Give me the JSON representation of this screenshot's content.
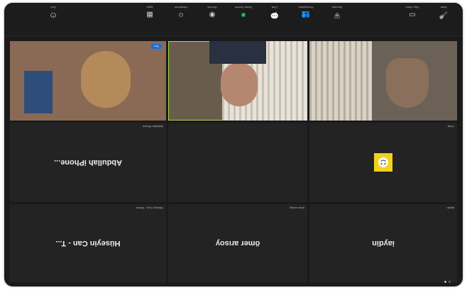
{
  "participants": [
    {
      "display_name": "Abdullah iPhone...",
      "tag": "Abdullah iPhone",
      "type": "name"
    },
    {
      "display_name": "Hüseyin Can - T...",
      "tag": "Hüseyin Can - Teknik",
      "type": "name"
    },
    {
      "display_name": "ömer arısoy",
      "tag": "ömer arısoy",
      "type": "name"
    },
    {
      "display_name": "iaydin",
      "tag": "iaydin",
      "type": "name"
    },
    {
      "tag": "Cihat",
      "type": "avatar"
    },
    {
      "tag": "",
      "type": "video"
    },
    {
      "tag": "",
      "type": "video"
    },
    {
      "tag": "",
      "type": "video"
    }
  ],
  "toolbar": {
    "items": [
      {
        "label": "Mute",
        "icon": "mic-icon"
      },
      {
        "label": "Stop Video",
        "icon": "video-icon"
      },
      {
        "label": "Security",
        "icon": "shield-icon"
      },
      {
        "label": "Participants",
        "icon": "participants-icon"
      },
      {
        "label": "Chat",
        "icon": "chat-icon"
      },
      {
        "label": "Share Screen",
        "icon": "share-screen-icon"
      },
      {
        "label": "Record",
        "icon": "record-icon"
      },
      {
        "label": "Reactions",
        "icon": "reactions-icon"
      },
      {
        "label": "Apps",
        "icon": "apps-icon"
      },
      {
        "label": "End",
        "icon": "end-icon"
      }
    ]
  },
  "self_view": {
    "label": "You"
  },
  "colors": {
    "share": "#1fbf5a",
    "active_speaker": "#a6d94a",
    "name_pill": "#1e6fd9"
  }
}
